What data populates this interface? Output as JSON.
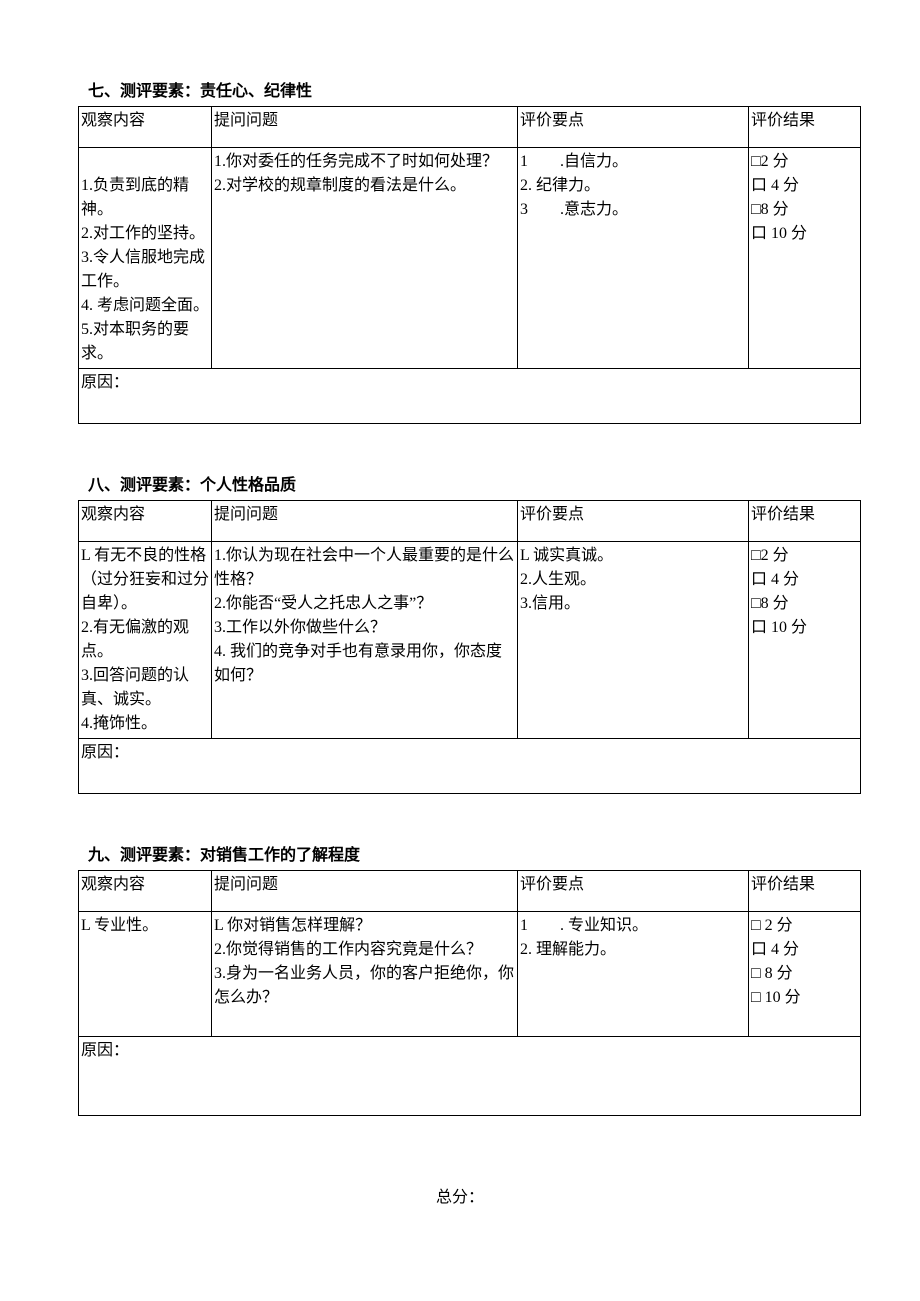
{
  "sections": [
    {
      "title": "七、测评要素：责任心、纪律性",
      "headers": {
        "c1": "观察内容",
        "c2": "提问问题",
        "c3": "评价要点",
        "c4": "评价结果"
      },
      "observe": "\n1.负责到底的精神。\n2.对工作的坚持。\n3.令人信服地完成工作。\n4. 考虑问题全面。\n5.对本职务的要求。",
      "questions": "1.你对委任的任务完成不了时如何处理？\n2.对学校的规章制度的看法是什么。",
      "points": "1　　.自信力。\n2. 纪律力。\n3　　.意志力。",
      "scores": [
        "□2 分",
        "口 4 分",
        "□8 分",
        "口 10 分"
      ],
      "reason": "原因："
    },
    {
      "title": "八、测评要素：个人性格品质",
      "headers": {
        "c1": "观察内容",
        "c2": "提问问题",
        "c3": "评价要点",
        "c4": "评价结果"
      },
      "observe": "L 有无不良的性格（过分狂妄和过分自卑）。\n2.有无偏激的观点。\n3.回答问题的认真、诚实。\n4.掩饰性。",
      "questions": "1.你认为现在社会中一个人最重要的是什么性格？\n2.你能否“受人之托忠人之事”？\n3.工作以外你做些什么？\n4. 我们的竞争对手也有意录用你，你态度如何？",
      "points": "L 诚实真诚。\n2.人生观。\n3.信用。",
      "scores": [
        "□2 分",
        "口 4 分",
        "□8 分",
        "口 10 分"
      ],
      "reason": "原因："
    },
    {
      "title": "九、测评要素：对销售工作的了解程度",
      "headers": {
        "c1": "观察内容",
        "c2": "提问问题",
        "c3": "评价要点",
        "c4": "评价结果"
      },
      "observe": "L 专业性。",
      "questions": "L 你对销售怎样理解？\n2.你觉得销售的工作内容究竟是什么？\n3.身为一名业务人员，你的客户拒绝你，你怎么办？\n ",
      "points": "1　　. 专业知识。\n2. 理解能力。",
      "scores": [
        "□   2 分",
        "口 4 分",
        "□   8 分",
        "□   10 分"
      ],
      "reason": "原因：\n "
    }
  ],
  "total": "总分："
}
